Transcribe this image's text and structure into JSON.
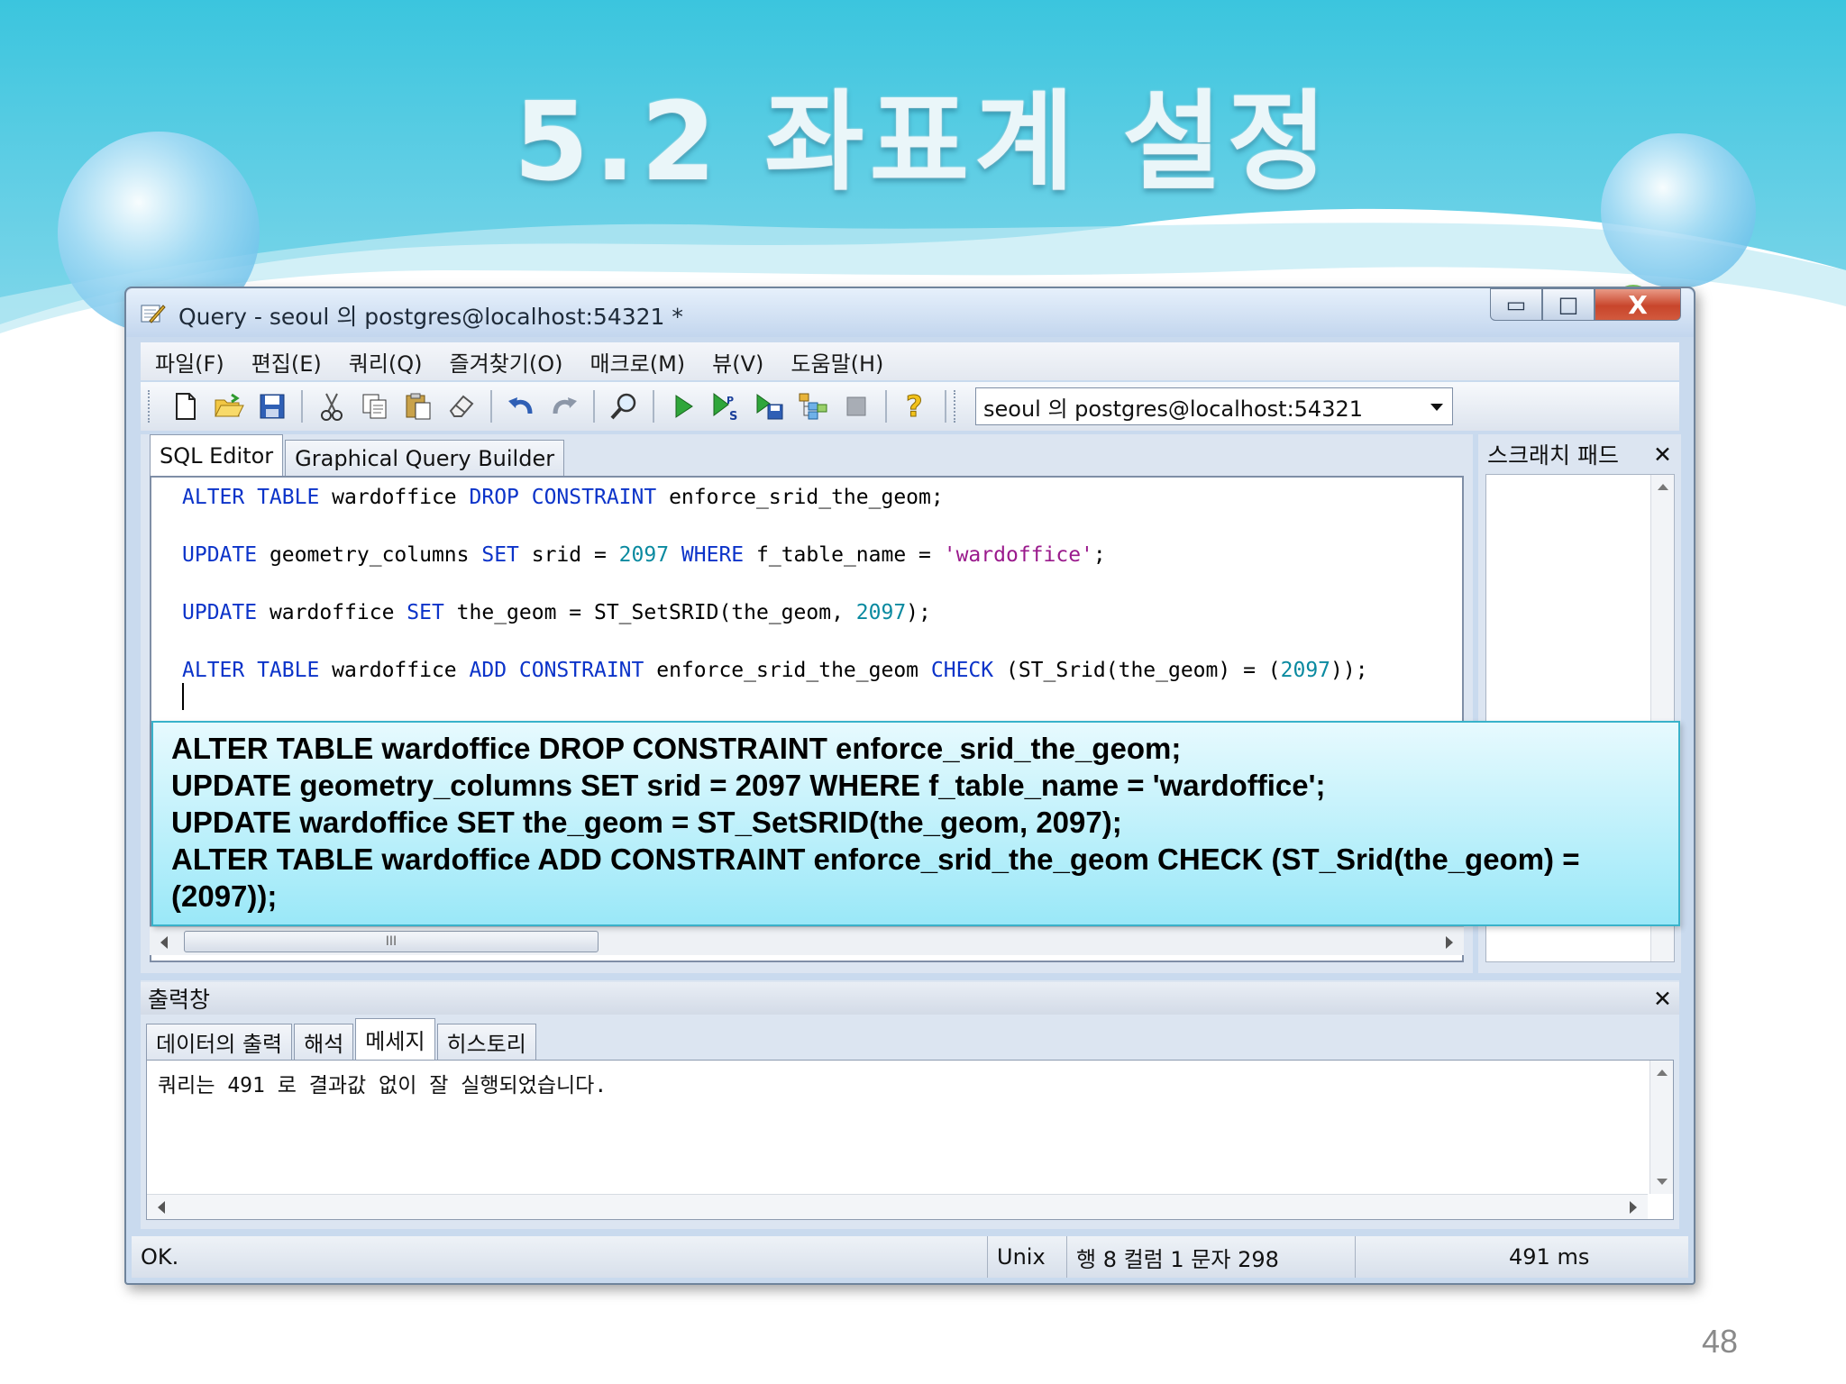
{
  "slide": {
    "title": "5.2 좌표계 설정",
    "page_number": "48"
  },
  "window": {
    "title": "Query - seoul 의 postgres@localhost:54321 *",
    "controls": {
      "minimize": "▭",
      "maximize": "□",
      "close": "X"
    }
  },
  "menu": {
    "items": [
      "파일(F)",
      "편집(E)",
      "쿼리(Q)",
      "즐겨찾기(O)",
      "매크로(M)",
      "뷰(V)",
      "도움말(H)"
    ]
  },
  "toolbar": {
    "icons": [
      "new-file-icon",
      "open-folder-icon",
      "save-icon",
      "cut-icon",
      "copy-icon",
      "paste-icon",
      "clear-icon",
      "undo-icon",
      "redo-icon",
      "find-icon",
      "execute-icon",
      "execute-pgscript-icon",
      "execute-to-file-icon",
      "explain-icon",
      "stop-icon",
      "help-icon"
    ],
    "connection": "seoul 의 postgres@localhost:54321"
  },
  "editor": {
    "tabs": [
      "SQL Editor",
      "Graphical Query Builder"
    ],
    "lines": [
      [
        {
          "t": "ALTER TABLE",
          "c": "kw"
        },
        {
          "t": " wardoffice ",
          "c": ""
        },
        {
          "t": "DROP CONSTRAINT",
          "c": "kw"
        },
        {
          "t": " enforce_srid_the_geom;",
          "c": ""
        }
      ],
      [
        {
          "t": "UPDATE",
          "c": "kw"
        },
        {
          "t": " geometry_columns ",
          "c": ""
        },
        {
          "t": "SET",
          "c": "kw"
        },
        {
          "t": " srid = ",
          "c": ""
        },
        {
          "t": "2097",
          "c": "num"
        },
        {
          "t": " ",
          "c": ""
        },
        {
          "t": "WHERE",
          "c": "kw"
        },
        {
          "t": " f_table_name = ",
          "c": ""
        },
        {
          "t": "'wardoffice'",
          "c": "str"
        },
        {
          "t": ";",
          "c": ""
        }
      ],
      [
        {
          "t": "UPDATE",
          "c": "kw"
        },
        {
          "t": " wardoffice ",
          "c": ""
        },
        {
          "t": "SET",
          "c": "kw"
        },
        {
          "t": " the_geom = ST_SetSRID(the_geom, ",
          "c": ""
        },
        {
          "t": "2097",
          "c": "num"
        },
        {
          "t": ");",
          "c": ""
        }
      ],
      [
        {
          "t": "ALTER TABLE",
          "c": "kw"
        },
        {
          "t": " wardoffice ",
          "c": ""
        },
        {
          "t": "ADD CONSTRAINT",
          "c": "kw"
        },
        {
          "t": " enforce_srid_the_geom ",
          "c": ""
        },
        {
          "t": "CHECK",
          "c": "kw"
        },
        {
          "t": " (ST_Srid(the_geom) = (",
          "c": ""
        },
        {
          "t": "2097",
          "c": "num"
        },
        {
          "t": "));",
          "c": ""
        }
      ]
    ],
    "hscroll_thumb": "III"
  },
  "scratch_pad": {
    "title": "스크래치 패드",
    "close": "✕"
  },
  "callout": {
    "lines": [
      "ALTER TABLE wardoffice DROP CONSTRAINT enforce_srid_the_geom;",
      "UPDATE geometry_columns SET srid = 2097 WHERE f_table_name = 'wardoffice';",
      "UPDATE wardoffice SET the_geom = ST_SetSRID(the_geom, 2097);",
      "ALTER TABLE wardoffice ADD CONSTRAINT enforce_srid_the_geom CHECK (ST_Srid(the_geom) =",
      "(2097));"
    ]
  },
  "output": {
    "title": "출력창",
    "close": "✕",
    "tabs": [
      "데이터의 출력",
      "해석",
      "메세지",
      "히스토리"
    ],
    "active_tab": 2,
    "message": "쿼리는 491 로 결과값 없이 잘 실행되었습니다."
  },
  "status": {
    "text": "OK.",
    "line_ending": "Unix",
    "position": "행 8 컬럼 1 문자 298",
    "duration": "491 ms"
  },
  "colors": {
    "keyword": "#0b33c9",
    "number": "#0a8aa0",
    "string": "#9a1a8c",
    "callout_border": "#39b2ca",
    "close_button": "#c8452b"
  }
}
